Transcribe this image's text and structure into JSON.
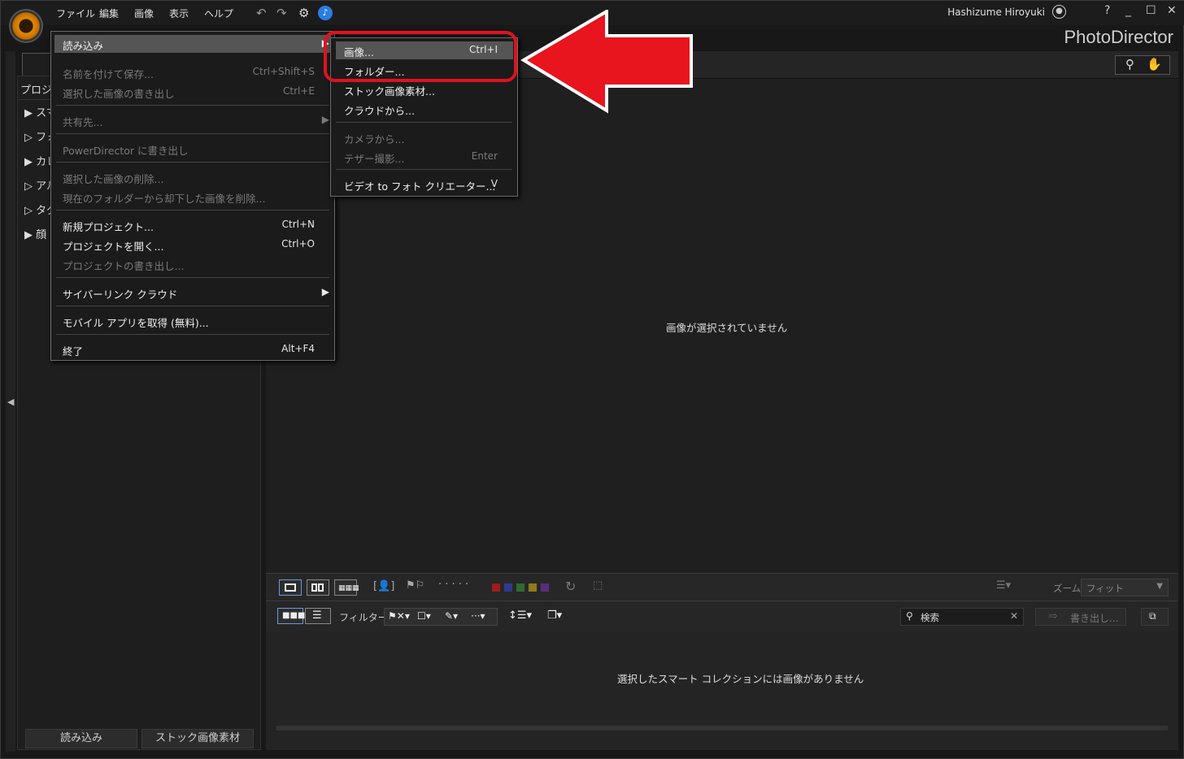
{
  "menubar": {
    "file": "ファイル",
    "edit": "編集",
    "image": "画像",
    "view": "表示",
    "help": "ヘルプ"
  },
  "user": "Hashizume Hiroyuki",
  "help_btn": "?",
  "app_name": "PhotoDirector",
  "left_panel": {
    "header": "プロジェ",
    "items": [
      "スマ",
      "フォ",
      "カレ",
      "アル",
      "タグ",
      "顔"
    ],
    "import_button": "読み込み",
    "stock_button": "ストック画像素材"
  },
  "main": {
    "empty_message": "画像が選択されていません"
  },
  "filmstrip": {
    "empty_message": "選択したスマート コレクションには画像がありません"
  },
  "toolbar": {
    "zoom_label": "ズーム:",
    "zoom_value": "フィット",
    "filter_label": "フィルター:",
    "search_placeholder": "検索",
    "export_label": "書き出し..."
  },
  "file_menu": {
    "items": [
      {
        "label": "読み込み",
        "shortcut": "",
        "enabled": true,
        "submenu": true
      },
      {
        "label": "名前を付けて保存...",
        "shortcut": "Ctrl+Shift+S",
        "enabled": false
      },
      {
        "label": "選択した画像の書き出し",
        "shortcut": "Ctrl+E",
        "enabled": false
      },
      {
        "label": "共有先...",
        "shortcut": "",
        "enabled": false,
        "submenu": true
      },
      {
        "label": "PowerDirector に書き出し",
        "shortcut": "",
        "enabled": false
      },
      {
        "label": "選択した画像の削除...",
        "shortcut": "",
        "enabled": false
      },
      {
        "label": "現在のフォルダーから却下した画像を削除...",
        "shortcut": "",
        "enabled": false
      },
      {
        "label": "新規プロジェクト...",
        "shortcut": "Ctrl+N",
        "enabled": true
      },
      {
        "label": "プロジェクトを開く...",
        "shortcut": "Ctrl+O",
        "enabled": true
      },
      {
        "label": "プロジェクトの書き出し...",
        "shortcut": "",
        "enabled": false
      },
      {
        "label": "サイバーリンク クラウド",
        "shortcut": "",
        "enabled": true,
        "submenu": true
      },
      {
        "label": "モバイル アプリを取得 (無料)...",
        "shortcut": "",
        "enabled": true
      },
      {
        "label": "終了",
        "shortcut": "Alt+F4",
        "enabled": true
      }
    ]
  },
  "import_submenu": {
    "items": [
      {
        "label": "画像...",
        "shortcut": "Ctrl+I",
        "enabled": true
      },
      {
        "label": "フォルダー...",
        "shortcut": "",
        "enabled": true
      },
      {
        "label": "ストック画像素材...",
        "shortcut": "",
        "enabled": true
      },
      {
        "label": "クラウドから...",
        "shortcut": "",
        "enabled": true
      },
      {
        "label": "カメラから...",
        "shortcut": "",
        "enabled": false
      },
      {
        "label": "テザー撮影...",
        "shortcut": "Enter",
        "enabled": false
      },
      {
        "label": "ビデオ to フォト クリエーター...",
        "shortcut": "V",
        "enabled": true
      }
    ]
  },
  "colors": {
    "highlight_ring": "#e0121f",
    "arrow": "#e8141e",
    "menu_hover": "#555555"
  }
}
